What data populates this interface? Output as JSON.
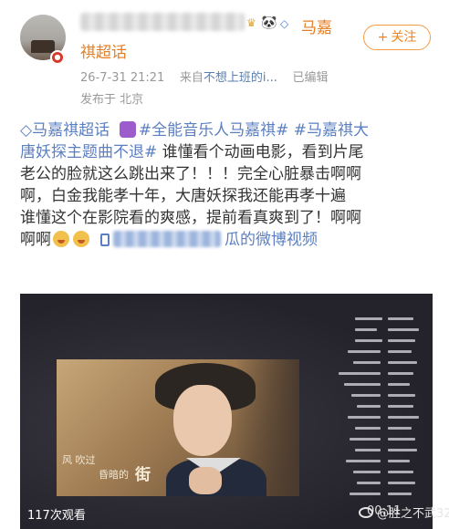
{
  "post": {
    "user_name_part1": "马嘉",
    "user_name_part2": "祺超话",
    "follow_button": "关注",
    "follow_plus": "+",
    "timestamp": "26-7-31 21:21",
    "source_prefix": "来自",
    "source_name": "不想上班的i...",
    "edited": "已编辑",
    "location": "发布于 北京"
  },
  "body": {
    "topic_super": "马嘉祺超话",
    "topic_1": "#全能音乐人马嘉祺#",
    "topic_2_part1": "#马嘉祺大",
    "topic_2_part2": "唐妖探主题曲不退#",
    "text_1": "谁懂看个动画电影，看到片尾",
    "text_2": "老公的脸就这么跳出来了！！！完全心脏暴击啊啊",
    "text_3": "啊，白金我能孝十年，大唐妖探我还能再孝十遍",
    "text_4": "谁懂这个在影院看的爽感，提前看真爽到了！啊啊",
    "text_5": "啊啊",
    "video_link_tail": "瓜的微博视频"
  },
  "video": {
    "subtitle_a": "风 吹过",
    "subtitle_b": "昏暗的",
    "subtitle_c": "街",
    "views": "117次观看",
    "timecode": "00:11"
  },
  "watermark": {
    "text": "@胜之不武32"
  },
  "colors": {
    "accent_orange": "#e57e22",
    "link_blue": "#5b7fc1",
    "muted_gray": "#999999"
  },
  "icons": [
    "crown-icon",
    "panda-icon",
    "diamond-icon",
    "superchat-diamond-icon",
    "heart-emoji-icon",
    "face-emoji-icon",
    "video-link-icon",
    "weibo-logo-icon"
  ]
}
